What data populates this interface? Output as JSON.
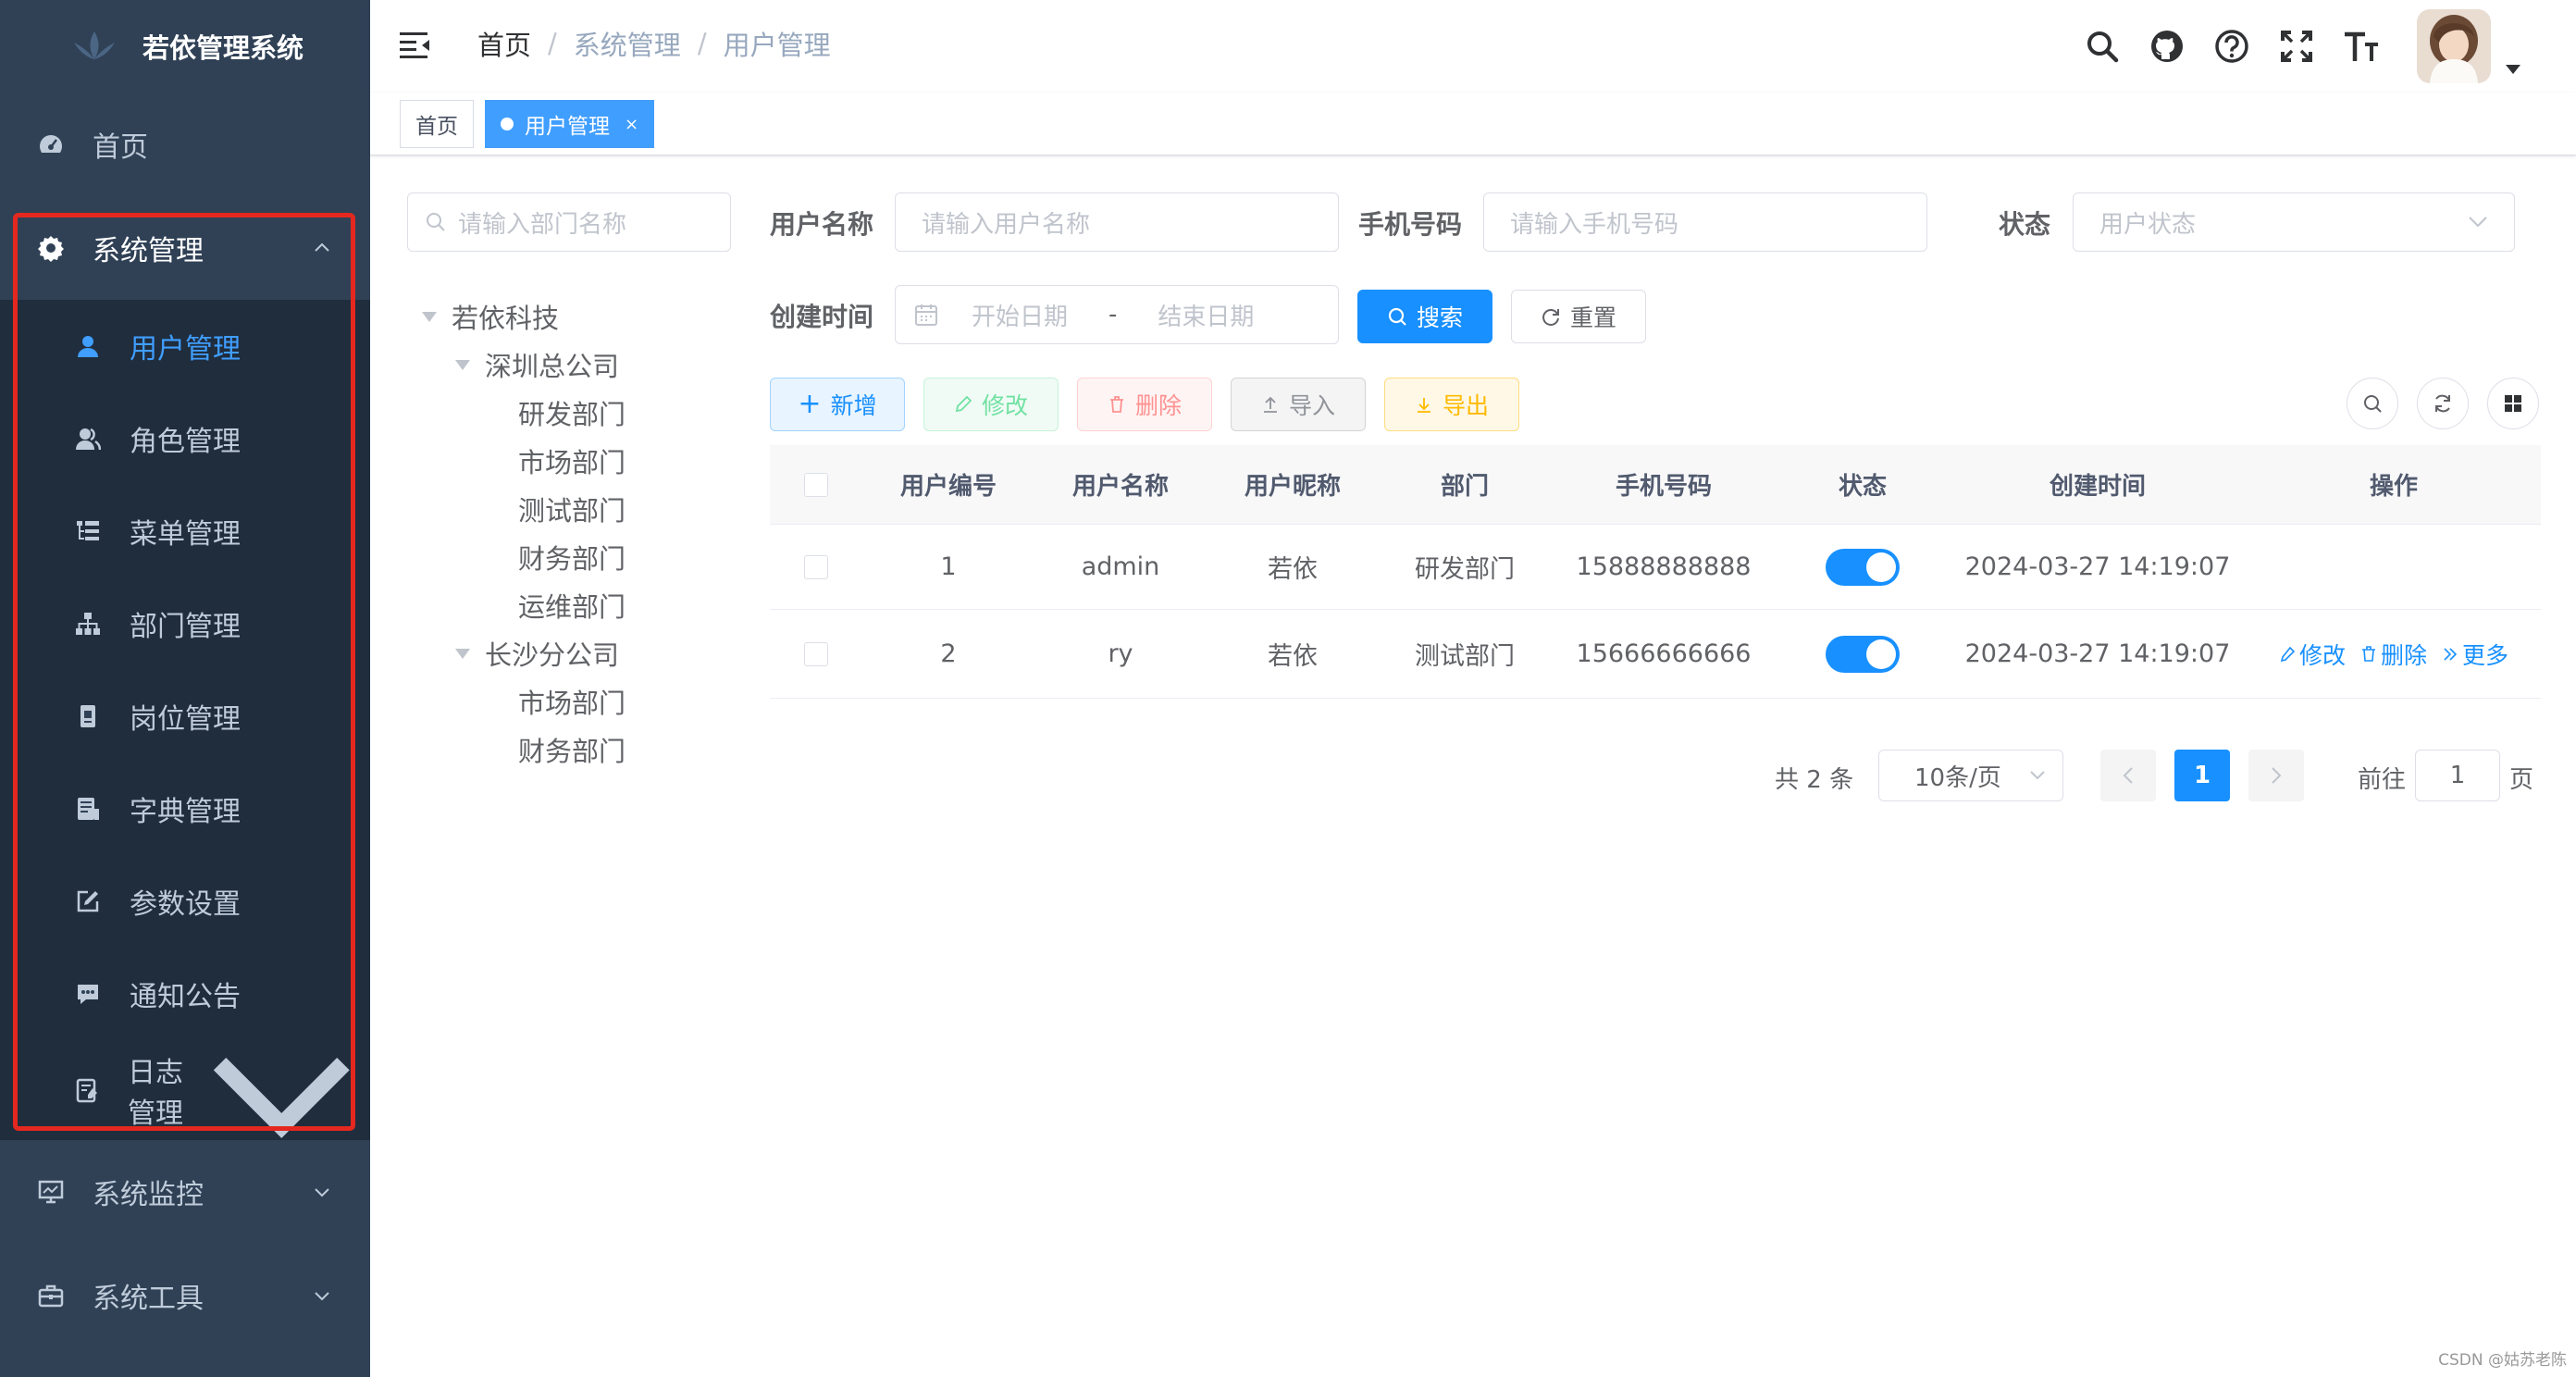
{
  "app": {
    "title": "若依管理系统"
  },
  "sidebar": {
    "items": [
      {
        "label": "首页",
        "icon": "dashboard-icon"
      },
      {
        "label": "系统管理",
        "icon": "gear-icon",
        "expanded": true
      },
      {
        "label": "系统监控",
        "icon": "monitor-icon"
      },
      {
        "label": "系统工具",
        "icon": "toolbox-icon"
      }
    ],
    "sub_items": [
      {
        "label": "用户管理",
        "icon": "user-icon",
        "active": true
      },
      {
        "label": "角色管理",
        "icon": "peoples-icon"
      },
      {
        "label": "菜单管理",
        "icon": "tree-table-icon"
      },
      {
        "label": "部门管理",
        "icon": "org-tree-icon"
      },
      {
        "label": "岗位管理",
        "icon": "post-icon"
      },
      {
        "label": "字典管理",
        "icon": "dict-icon"
      },
      {
        "label": "参数设置",
        "icon": "edit-icon"
      },
      {
        "label": "通知公告",
        "icon": "message-icon"
      },
      {
        "label": "日志管理",
        "icon": "log-icon"
      }
    ]
  },
  "navbar": {
    "breadcrumb": [
      "首页",
      "系统管理",
      "用户管理"
    ],
    "separator": "/"
  },
  "tags": [
    {
      "label": "首页",
      "active": false
    },
    {
      "label": "用户管理",
      "active": true,
      "close": "×"
    }
  ],
  "dept_tree": {
    "search_placeholder": "请输入部门名称",
    "nodes": [
      "若依科技",
      "深圳总公司",
      "研发部门",
      "市场部门",
      "测试部门",
      "财务部门",
      "运维部门",
      "长沙分公司",
      "市场部门",
      "财务部门"
    ]
  },
  "search_form": {
    "username_label": "用户名称",
    "username_placeholder": "请输入用户名称",
    "phone_label": "手机号码",
    "phone_placeholder": "请输入手机号码",
    "status_label": "状态",
    "status_placeholder": "用户状态",
    "created_label": "创建时间",
    "start_placeholder": "开始日期",
    "range_sep": "-",
    "end_placeholder": "结束日期",
    "search_btn": "搜索",
    "reset_btn": "重置"
  },
  "toolbar": {
    "add": "新增",
    "edit": "修改",
    "delete": "删除",
    "import": "导入",
    "export": "导出"
  },
  "table": {
    "columns": [
      "用户编号",
      "用户名称",
      "用户昵称",
      "部门",
      "手机号码",
      "状态",
      "创建时间",
      "操作"
    ],
    "rows": [
      {
        "id": "1",
        "username": "admin",
        "nickname": "若依",
        "dept": "研发部门",
        "phone": "15888888888",
        "status": true,
        "created": "2024-03-27 14:19:07"
      },
      {
        "id": "2",
        "username": "ry",
        "nickname": "若依",
        "dept": "测试部门",
        "phone": "15666666666",
        "status": true,
        "created": "2024-03-27 14:19:07"
      }
    ],
    "actions": {
      "edit": "修改",
      "delete": "删除",
      "more": "更多"
    }
  },
  "pagination": {
    "total": "共 2 条",
    "page_size": "10条/页",
    "current": "1",
    "goto_label": "前往",
    "goto_value": "1",
    "page_suffix": "页"
  },
  "watermark": "CSDN @姑苏老陈",
  "colors": {
    "sidebar_bg": "#304156",
    "submenu_bg": "#1f2d3d",
    "primary": "#1890ff",
    "active_text": "#409eff",
    "highlight": "#e5281f"
  }
}
